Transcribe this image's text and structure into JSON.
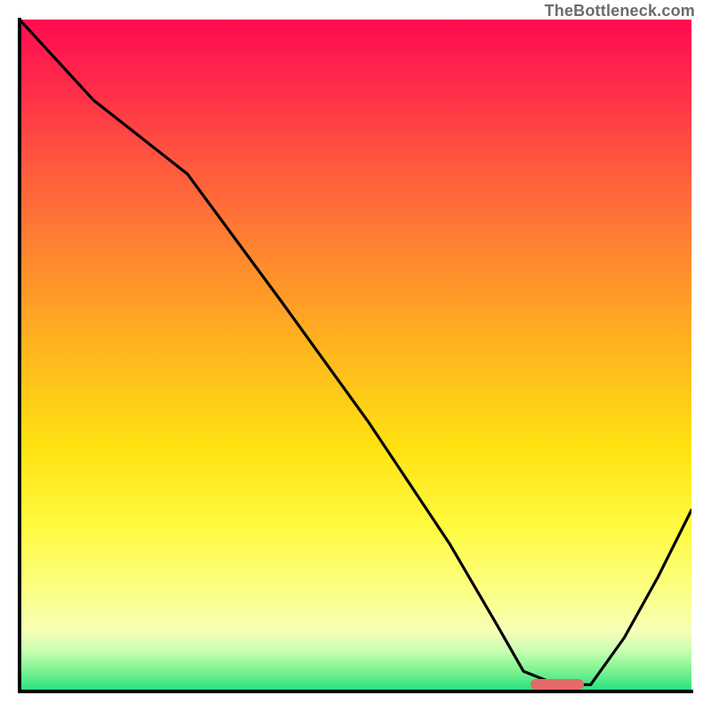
{
  "watermark": "TheBottleneck.com",
  "colors": {
    "axis": "#000000",
    "curve": "#000000",
    "marker": "#e46a6a",
    "gradient_top": "#ff0a52",
    "gradient_mid": "#ffe312",
    "gradient_bottom": "#20e07f"
  },
  "chart_data": {
    "type": "line",
    "title": "",
    "xlabel": "",
    "ylabel": "",
    "xlim": [
      0,
      100
    ],
    "ylim": [
      0,
      100
    ],
    "x": [
      0,
      11,
      25,
      39,
      52,
      64,
      71,
      75,
      80,
      85,
      90,
      95,
      100
    ],
    "values": [
      100,
      88,
      77,
      58,
      40,
      22,
      10,
      3,
      1,
      1,
      8,
      17,
      27
    ],
    "marker": {
      "x_start": 76,
      "x_end": 84,
      "y": 1
    },
    "grid": false,
    "legend": null
  }
}
